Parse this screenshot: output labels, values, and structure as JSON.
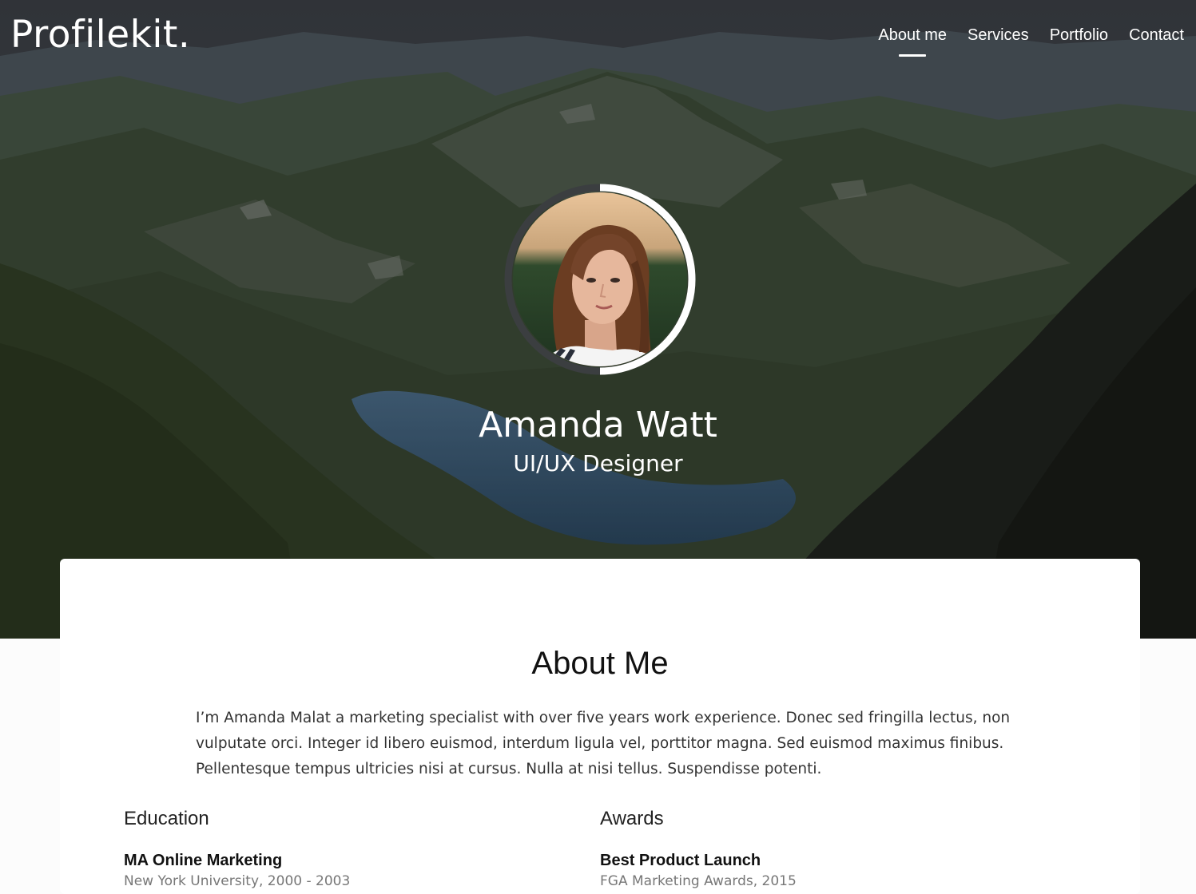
{
  "brand": {
    "logo": "Profilekit."
  },
  "nav": {
    "items": [
      {
        "label": "About me",
        "active": true
      },
      {
        "label": "Services"
      },
      {
        "label": "Portfolio"
      },
      {
        "label": "Contact"
      }
    ]
  },
  "hero": {
    "background": "mountain-lake-landscape-photo",
    "avatar": "woman-portrait-photo",
    "name": "Amanda Watt",
    "role": "UI/UX Designer"
  },
  "about": {
    "title": "About Me",
    "text": "I’m Amanda Malat a marketing specialist with over five years work experience. Donec sed fringilla lectus, non vulputate orci. Integer id libero euismod, interdum ligula vel, porttitor magna. Sed euismod maximus finibus. Pellentesque tempus ultricies nisi at cursus. Nulla at nisi tellus. Suspendisse potenti."
  },
  "education": {
    "title": "Education",
    "items": [
      {
        "title": "MA Online Marketing",
        "sub": "New York University, 2000 - 2003"
      }
    ]
  },
  "awards": {
    "title": "Awards",
    "items": [
      {
        "title": "Best Product Launch",
        "sub": "FGA Marketing Awards, 2015"
      }
    ]
  },
  "colors": {
    "text_dark": "#111111",
    "text_body": "#333333",
    "text_muted": "#777777",
    "card": "#ffffff"
  }
}
